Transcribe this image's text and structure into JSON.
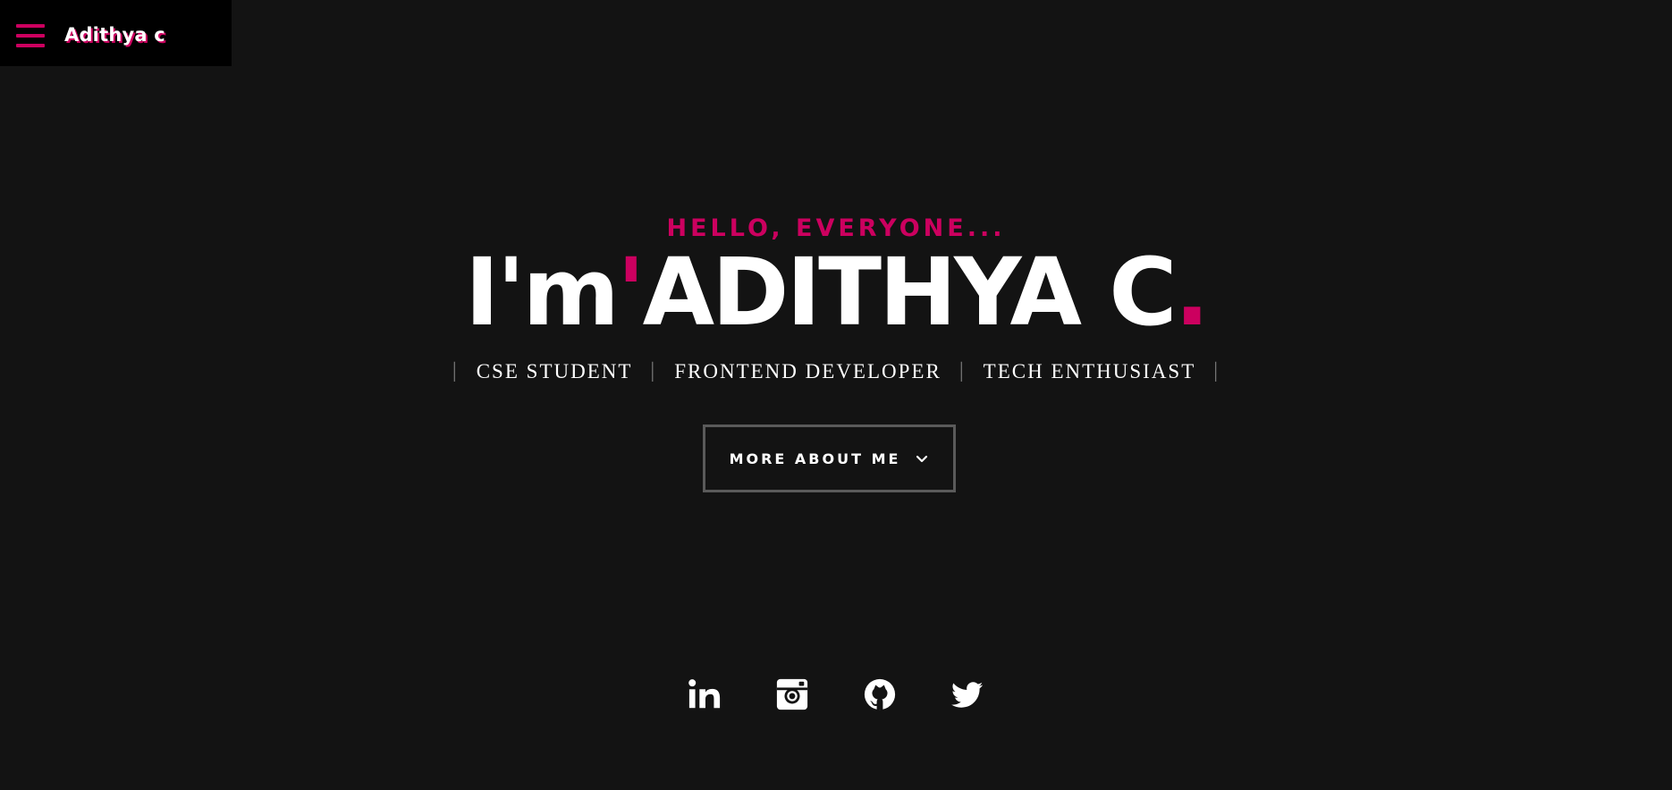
{
  "nav": {
    "brand": "Adithya c",
    "menu_icon": "hamburger-menu-icon"
  },
  "hero": {
    "greeting": "HELLO, EVERYONE...",
    "headline_prefix": "I'm",
    "headline_apostrophe": "'",
    "headline_name": "ADITHYA C",
    "headline_dot": ".",
    "roles": [
      "CSE STUDENT",
      "FRONTEND DEVELOPER",
      "TECH ENTHUSIAST"
    ],
    "separator": "|",
    "cta_label": "MORE ABOUT ME",
    "cta_icon": "chevron-down-icon"
  },
  "socials": [
    {
      "name": "linkedin",
      "icon": "linkedin-icon"
    },
    {
      "name": "instagram",
      "icon": "instagram-icon"
    },
    {
      "name": "github",
      "icon": "github-icon"
    },
    {
      "name": "twitter",
      "icon": "twitter-icon"
    }
  ],
  "colors": {
    "background": "#131313",
    "topbar": "#000000",
    "accent": "#cc005f",
    "text": "#ffffff",
    "muted": "#7a7a7a",
    "button_border": "#5a5a5a"
  }
}
